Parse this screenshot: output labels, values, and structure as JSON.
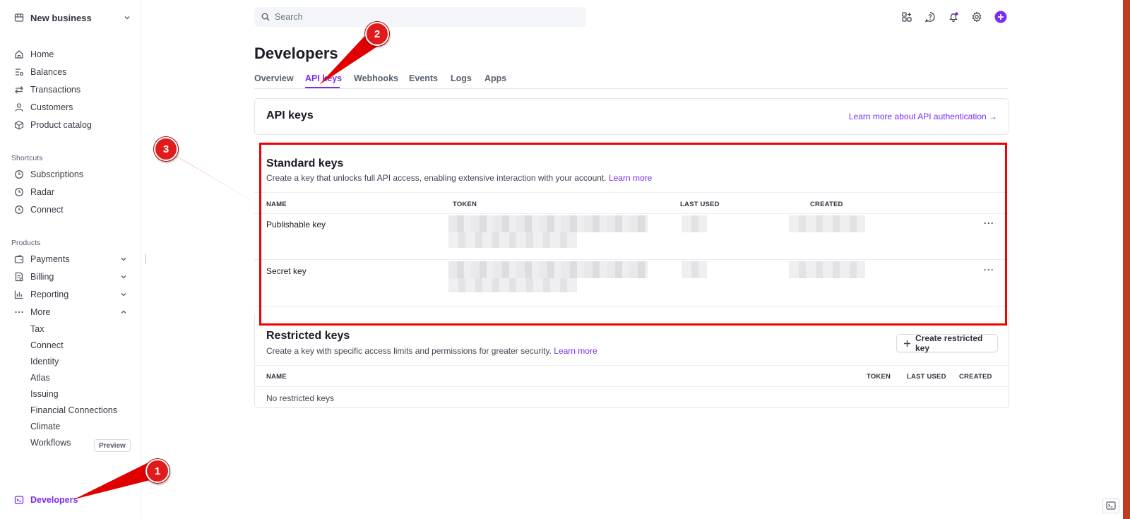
{
  "sidebar": {
    "business_name": "New business",
    "items": [
      {
        "label": "Home",
        "icon": "home-icon"
      },
      {
        "label": "Balances",
        "icon": "balances-icon"
      },
      {
        "label": "Transactions",
        "icon": "transactions-icon"
      },
      {
        "label": "Customers",
        "icon": "customers-icon"
      },
      {
        "label": "Product catalog",
        "icon": "product-catalog-icon"
      }
    ],
    "shortcuts_heading": "Shortcuts",
    "shortcuts": [
      {
        "label": "Subscriptions",
        "icon": "clock-icon"
      },
      {
        "label": "Radar",
        "icon": "clock-icon"
      },
      {
        "label": "Connect",
        "icon": "clock-icon"
      }
    ],
    "products_heading": "Products",
    "products": [
      {
        "label": "Payments",
        "icon": "wallet-icon"
      },
      {
        "label": "Billing",
        "icon": "billing-icon"
      },
      {
        "label": "Reporting",
        "icon": "reporting-icon"
      },
      {
        "label": "More",
        "icon": "more-icon"
      }
    ],
    "more_items": [
      "Tax",
      "Connect",
      "Identity",
      "Atlas",
      "Issuing",
      "Financial Connections",
      "Climate",
      "Workflows"
    ],
    "workflows_badge": "Preview",
    "developers_label": "Developers"
  },
  "search": {
    "placeholder": "Search"
  },
  "page": {
    "title": "Developers",
    "tabs": [
      "Overview",
      "API keys",
      "Webhooks",
      "Events",
      "Logs",
      "Apps"
    ],
    "active_tab": "API keys"
  },
  "api_keys_card": {
    "title": "API keys",
    "link": "Learn more about API authentication →"
  },
  "standard_keys": {
    "title": "Standard keys",
    "description": "Create a key that unlocks full API access, enabling extensive interaction with your account.",
    "learn_more": "Learn more",
    "columns": [
      "NAME",
      "TOKEN",
      "LAST USED",
      "CREATED"
    ],
    "rows": [
      {
        "name": "Publishable key",
        "menu": "···"
      },
      {
        "name": "Secret key",
        "menu": "···"
      }
    ]
  },
  "restricted_keys": {
    "title": "Restricted keys",
    "description": "Create a key with specific access limits and permissions for greater security.",
    "learn_more": "Learn more",
    "button": "Create restricted key",
    "columns": [
      "NAME",
      "TOKEN",
      "LAST USED",
      "CREATED"
    ],
    "empty": "No restricted keys"
  },
  "annotations": {
    "markers": [
      "1",
      "2",
      "3"
    ]
  },
  "colors": {
    "accent": "#7a2cf5",
    "annotation_red": "#f10000"
  }
}
